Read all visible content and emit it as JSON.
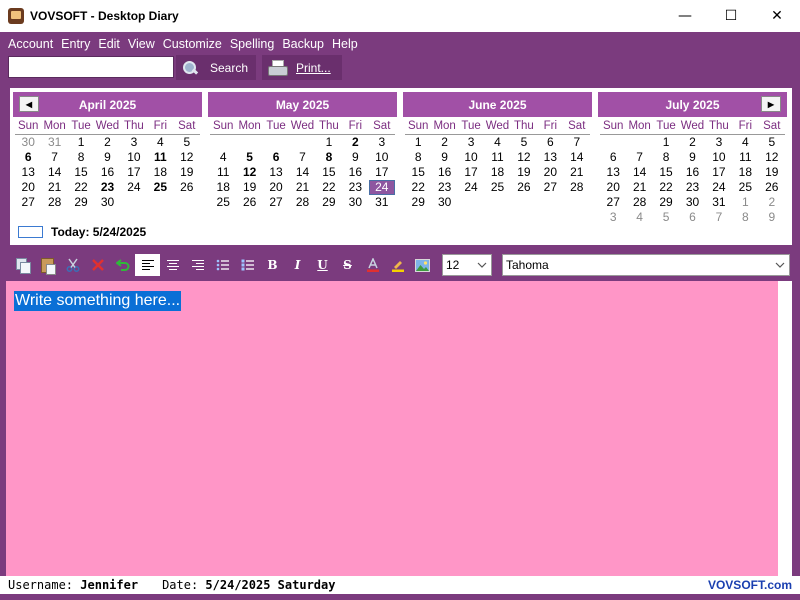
{
  "window": {
    "title": "VOVSOFT - Desktop Diary",
    "minimize": "—",
    "maximize": "☐",
    "close": "✕"
  },
  "menu": [
    "Account",
    "Entry",
    "Edit",
    "View",
    "Customize",
    "Spelling",
    "Backup",
    "Help"
  ],
  "search": {
    "value": "",
    "placeholder": "",
    "button_label": "Search"
  },
  "print": {
    "button_label": "Print..."
  },
  "calendar": {
    "dow": [
      "Sun",
      "Mon",
      "Tue",
      "Wed",
      "Thu",
      "Fri",
      "Sat"
    ],
    "months": [
      {
        "name": "April 2025",
        "days": [
          {
            "d": "30",
            "cls": "other"
          },
          {
            "d": "31",
            "cls": "other"
          },
          {
            "d": "1"
          },
          {
            "d": "2"
          },
          {
            "d": "3"
          },
          {
            "d": "4"
          },
          {
            "d": "5"
          },
          {
            "d": "6",
            "cls": "bold"
          },
          {
            "d": "7"
          },
          {
            "d": "8"
          },
          {
            "d": "9"
          },
          {
            "d": "10"
          },
          {
            "d": "11",
            "cls": "bold"
          },
          {
            "d": "12"
          },
          {
            "d": "13"
          },
          {
            "d": "14"
          },
          {
            "d": "15"
          },
          {
            "d": "16"
          },
          {
            "d": "17"
          },
          {
            "d": "18"
          },
          {
            "d": "19"
          },
          {
            "d": "20"
          },
          {
            "d": "21"
          },
          {
            "d": "22"
          },
          {
            "d": "23",
            "cls": "bold"
          },
          {
            "d": "24"
          },
          {
            "d": "25",
            "cls": "bold"
          },
          {
            "d": "26"
          },
          {
            "d": "27"
          },
          {
            "d": "28"
          },
          {
            "d": "29"
          },
          {
            "d": "30"
          }
        ]
      },
      {
        "name": "May 2025",
        "days": [
          {
            "d": "",
            "cls": "blank"
          },
          {
            "d": "",
            "cls": "blank"
          },
          {
            "d": "",
            "cls": "blank"
          },
          {
            "d": "",
            "cls": "blank"
          },
          {
            "d": "1"
          },
          {
            "d": "2",
            "cls": "bold"
          },
          {
            "d": "3"
          },
          {
            "d": "4"
          },
          {
            "d": "5",
            "cls": "bold"
          },
          {
            "d": "6",
            "cls": "bold"
          },
          {
            "d": "7"
          },
          {
            "d": "8",
            "cls": "bold"
          },
          {
            "d": "9"
          },
          {
            "d": "10"
          },
          {
            "d": "11"
          },
          {
            "d": "12",
            "cls": "bold"
          },
          {
            "d": "13"
          },
          {
            "d": "14"
          },
          {
            "d": "15"
          },
          {
            "d": "16"
          },
          {
            "d": "17"
          },
          {
            "d": "18"
          },
          {
            "d": "19"
          },
          {
            "d": "20"
          },
          {
            "d": "21"
          },
          {
            "d": "22"
          },
          {
            "d": "23"
          },
          {
            "d": "24",
            "cls": "selected"
          },
          {
            "d": "25"
          },
          {
            "d": "26"
          },
          {
            "d": "27"
          },
          {
            "d": "28"
          },
          {
            "d": "29"
          },
          {
            "d": "30"
          },
          {
            "d": "31"
          }
        ]
      },
      {
        "name": "June 2025",
        "days": [
          {
            "d": "1"
          },
          {
            "d": "2"
          },
          {
            "d": "3"
          },
          {
            "d": "4"
          },
          {
            "d": "5"
          },
          {
            "d": "6"
          },
          {
            "d": "7"
          },
          {
            "d": "8"
          },
          {
            "d": "9"
          },
          {
            "d": "10"
          },
          {
            "d": "11"
          },
          {
            "d": "12"
          },
          {
            "d": "13"
          },
          {
            "d": "14"
          },
          {
            "d": "15"
          },
          {
            "d": "16"
          },
          {
            "d": "17"
          },
          {
            "d": "18"
          },
          {
            "d": "19"
          },
          {
            "d": "20"
          },
          {
            "d": "21"
          },
          {
            "d": "22"
          },
          {
            "d": "23"
          },
          {
            "d": "24"
          },
          {
            "d": "25"
          },
          {
            "d": "26"
          },
          {
            "d": "27"
          },
          {
            "d": "28"
          },
          {
            "d": "29"
          },
          {
            "d": "30"
          }
        ]
      },
      {
        "name": "July 2025",
        "days": [
          {
            "d": "",
            "cls": "blank"
          },
          {
            "d": "",
            "cls": "blank"
          },
          {
            "d": "1"
          },
          {
            "d": "2"
          },
          {
            "d": "3"
          },
          {
            "d": "4"
          },
          {
            "d": "5"
          },
          {
            "d": "6"
          },
          {
            "d": "7"
          },
          {
            "d": "8"
          },
          {
            "d": "9"
          },
          {
            "d": "10"
          },
          {
            "d": "11"
          },
          {
            "d": "12"
          },
          {
            "d": "13"
          },
          {
            "d": "14"
          },
          {
            "d": "15"
          },
          {
            "d": "16"
          },
          {
            "d": "17"
          },
          {
            "d": "18"
          },
          {
            "d": "19"
          },
          {
            "d": "20"
          },
          {
            "d": "21"
          },
          {
            "d": "22"
          },
          {
            "d": "23"
          },
          {
            "d": "24"
          },
          {
            "d": "25"
          },
          {
            "d": "26"
          },
          {
            "d": "27"
          },
          {
            "d": "28"
          },
          {
            "d": "29"
          },
          {
            "d": "30"
          },
          {
            "d": "31"
          },
          {
            "d": "1",
            "cls": "other"
          },
          {
            "d": "2",
            "cls": "other"
          },
          {
            "d": "3",
            "cls": "other"
          },
          {
            "d": "4",
            "cls": "other"
          },
          {
            "d": "5",
            "cls": "other"
          },
          {
            "d": "6",
            "cls": "other"
          },
          {
            "d": "7",
            "cls": "other"
          },
          {
            "d": "8",
            "cls": "other"
          },
          {
            "d": "9",
            "cls": "other"
          }
        ]
      }
    ],
    "today_label": "Today: 5/24/2025"
  },
  "toolbar": {
    "icons": [
      "copy-icon",
      "paste-icon",
      "cut-icon",
      "delete-icon",
      "undo-icon",
      "align-left-icon",
      "align-center-icon",
      "align-right-icon",
      "bullet-list-icon",
      "numbered-list-icon",
      "bold-icon",
      "italic-icon",
      "underline-icon",
      "strikethrough-icon",
      "font-color-icon",
      "highlight-icon",
      "insert-image-icon"
    ],
    "font_size": "12",
    "font_name": "Tahoma"
  },
  "editor": {
    "text": "Write something here..."
  },
  "status": {
    "username_label": "Username:",
    "username": "Jennifer",
    "date_label": "Date:",
    "date": "5/24/2025 Saturday",
    "brand": "VOVSOFT.com"
  },
  "colors": {
    "frame": "#7b3b7e",
    "month_header": "#a150a6",
    "editor_bg": "#ff96c7",
    "selection": "#0a6fd6",
    "brand": "#1a3fb0"
  }
}
